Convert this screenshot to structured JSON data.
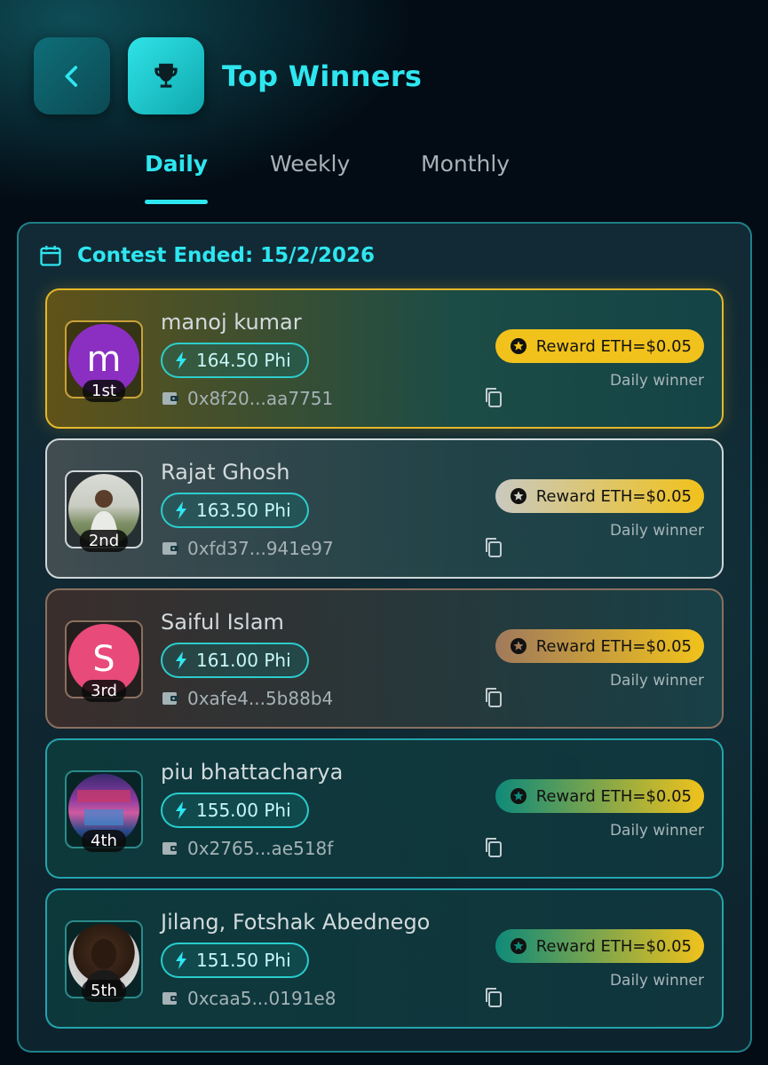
{
  "header": {
    "title": "Top Winners",
    "back_icon": "chevron-left-icon",
    "trophy_icon": "trophy-icon"
  },
  "tabs": [
    {
      "label": "Daily",
      "active": true
    },
    {
      "label": "Weekly",
      "active": false
    },
    {
      "label": "Monthly",
      "active": false
    }
  ],
  "contest": {
    "label": "Contest Ended: 15/2/2026",
    "icon": "calendar-icon"
  },
  "colors": {
    "accent": "#2ee6f0",
    "gold": "#f1c21b",
    "silver": "#d9d9d9",
    "bronze": "#a07a5c",
    "teal_reward": "#0e8a7a"
  },
  "winners": [
    {
      "rank": "1st",
      "name": "manoj kumar",
      "points": "164.50 Phi",
      "wallet": "0x8f20...aa7751",
      "reward": "Reward ETH=$0.05",
      "subtitle": "Daily winner",
      "avatar_letter": "m",
      "avatar_color": "#8b2fc2"
    },
    {
      "rank": "2nd",
      "name": "Rajat Ghosh",
      "points": "163.50 Phi",
      "wallet": "0xfd37...941e97",
      "reward": "Reward ETH=$0.05",
      "subtitle": "Daily winner",
      "avatar_letter": "",
      "avatar_color": "#9aa2a0"
    },
    {
      "rank": "3rd",
      "name": "Saiful Islam",
      "points": "161.00 Phi",
      "wallet": "0xafe4...5b88b4",
      "reward": "Reward ETH=$0.05",
      "subtitle": "Daily winner",
      "avatar_letter": "S",
      "avatar_color": "#e84a7a"
    },
    {
      "rank": "4th",
      "name": "piu bhattacharya",
      "points": "155.00 Phi",
      "wallet": "0x2765...ae518f",
      "reward": "Reward ETH=$0.05",
      "subtitle": "Daily winner",
      "avatar_letter": "",
      "avatar_color": "#6a3a8a"
    },
    {
      "rank": "5th",
      "name": "Jilang, Fotshak Abednego",
      "points": "151.50 Phi",
      "wallet": "0xcaa5...0191e8",
      "reward": "Reward ETH=$0.05",
      "subtitle": "Daily winner",
      "avatar_letter": "",
      "avatar_color": "#3a2a20"
    }
  ]
}
